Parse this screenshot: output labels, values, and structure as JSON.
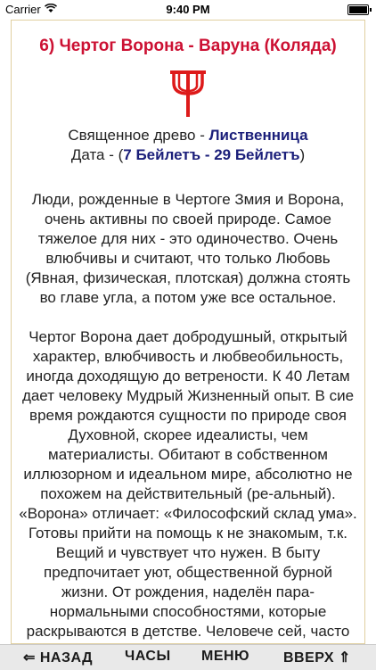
{
  "status": {
    "carrier": "Carrier",
    "time": "9:40 PM"
  },
  "article": {
    "title": "6) Чертог Ворона - Варуна (Коляда)",
    "tree_label": "Священное древо - ",
    "tree_value": "Лиственница",
    "date_label": "Дата - (",
    "date_value": "7 Бейлетъ - 29 Бейлетъ",
    "date_close": ")",
    "paragraph_1": "Люди, рожденные в Чертоге Змия и Ворона, очень активны по своей природе. Самое тяжелое для них - это одиночество. Очень влюбчивы и считают, что только Любовь (Явная, физическая, плотская) должна стоять во главе угла, а потом уже все остальное.",
    "paragraph_2": "Чертог Ворона дает добродушный, открытый характер, влюбчивость и любвеобильность, иногда доходящую до ветрености. К 40 Летам дает человеку Мудрый Жизненный опыт. В сие время рождаются сущности по природе своя Духовной, скорее идеалисты, чем материалисты. Обитают в собственном иллюзорном и идеальном мире, абсолютно не похожем на действительный (ре-альный). «Ворона» отличает: «Философский склад ума». Готовы прийти на помощь к не знакомым, т.к. Вещий и чувствует что нужен. В быту предпочитает уют, общественной бурной жизни. От рождения, наделён пара-нормальными способностями, которые раскрываются в детстве. Человече сей, часто не ведает: «Что с ними делать?» В детстве часто спрашивают о тех, или иных явлениях у"
  },
  "colors": {
    "title": "#cc1133",
    "accent": "#1b1f7a",
    "symbol": "#dd1a1a"
  },
  "symbol_icon": "trident-icon",
  "bottom_nav": {
    "back": "⇐ НАЗАД",
    "hours": "ЧАСЫ",
    "menu": "МЕНЮ",
    "up": "ВВЕРХ ⇑"
  }
}
